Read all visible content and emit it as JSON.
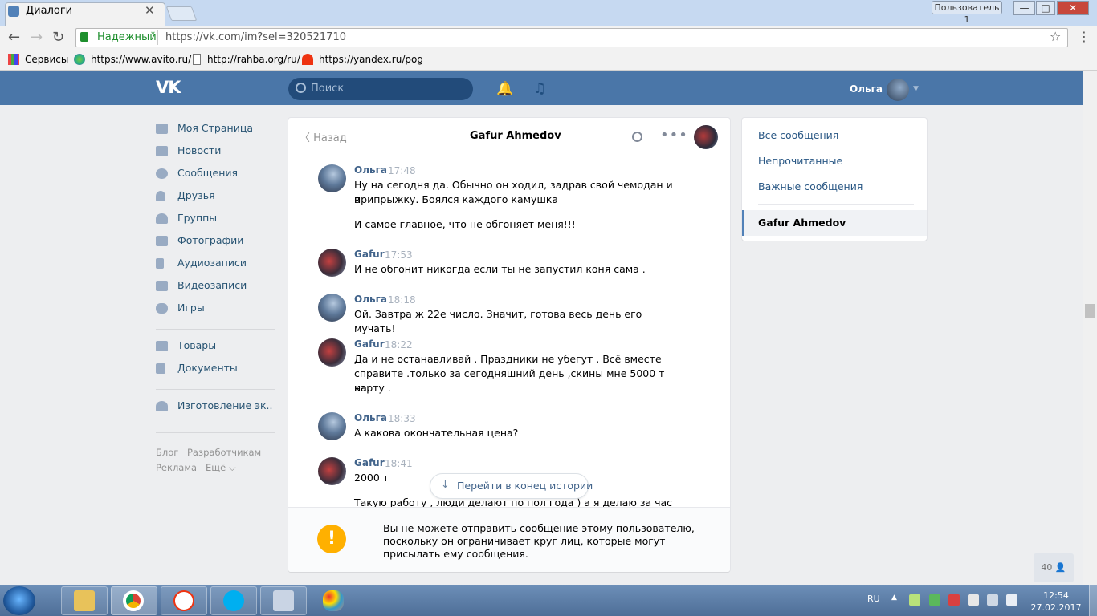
{
  "browser": {
    "tab_title": "Диалоги",
    "tab_close": "✕",
    "user_button": "Пользователь 1",
    "win_min": "—",
    "win_max": "□",
    "win_close": "✕",
    "back": "←",
    "forward": "→",
    "reload": "↻",
    "secure_label": "Надежный",
    "url": "https://vk.com/im?sel=320521710",
    "star": "☆",
    "menu": "⋮",
    "bookmarks": [
      "Сервисы",
      "https://www.avito.ru/",
      "http://rahba.org/ru/",
      "https://yandex.ru/pog"
    ]
  },
  "vk": {
    "logo": "VK",
    "search_placeholder": "Поиск",
    "bell": "🔔",
    "music": "♫",
    "user_name": "Ольга",
    "caret": "▼"
  },
  "left_menu": {
    "items": [
      "Моя Страница",
      "Новости",
      "Сообщения",
      "Друзья",
      "Группы",
      "Фотографии",
      "Аудиозаписи",
      "Видеозаписи",
      "Игры"
    ],
    "items2": [
      "Товары",
      "Документы"
    ],
    "items3": [
      "Изготовление эк.."
    ],
    "footer": [
      "Блог",
      "Разработчикам",
      "Реклама",
      "Ещё ⌵"
    ]
  },
  "chat": {
    "back_label": "Назад",
    "back_arrow": "〈",
    "peer_name": "Gafur Ahmedov",
    "more": "•••",
    "messages": [
      {
        "name": "Ольга",
        "time": "17:48",
        "lines": [
          "Ну на сегодня да. Обычно он ходил, задрав свой чемодан и в",
          "припрыжку. Боялся каждого камушка"
        ],
        "extra": "И самое главное, что не обгоняет меня!!!"
      },
      {
        "name": "Gafur",
        "time": "17:53",
        "lines": [
          "И не обгонит никогда если ты не запустил коня сама ."
        ]
      },
      {
        "name": "Ольга",
        "time": "18:18",
        "lines": [
          "Ой. Завтра ж 22е число. Значит, готова весь день его мучать!"
        ]
      },
      {
        "name": "Gafur",
        "time": "18:22",
        "lines": [
          "Да и не останавливай . Праздники не убегут . Всё вместе",
          "справите .только за сегодняшний день ,скины мне 5000 т на",
          "карту ."
        ]
      },
      {
        "name": "Ольга",
        "time": "18:33",
        "lines": [
          "А какова окончательная цена?"
        ]
      },
      {
        "name": "Gafur",
        "time": "18:41",
        "lines": [
          "2000 т"
        ],
        "extra": "Такую работу , люди делают по пол года ) а я делаю за час ."
      }
    ],
    "jump_label": "Перейти в конец истории",
    "jump_arrow": "↓",
    "blocked_icon": "!",
    "blocked_text": "Вы не можете отправить сообщение этому пользователю, поскольку он ограничивает круг лиц, которые могут присылать ему сообщения."
  },
  "filters": {
    "items": [
      "Все сообщения",
      "Непрочитанные",
      "Важные сообщения"
    ],
    "active": "Gafur Ahmedov"
  },
  "online_count": "40 👤",
  "taskbar": {
    "lang": "RU",
    "arrow": "▲",
    "time": "12:54",
    "date": "27.02.2017"
  },
  "colors": {
    "vk_blue": "#4a76a8",
    "link": "#42648b",
    "warning": "#ffb000",
    "taskbar": "#5a7aa3"
  }
}
